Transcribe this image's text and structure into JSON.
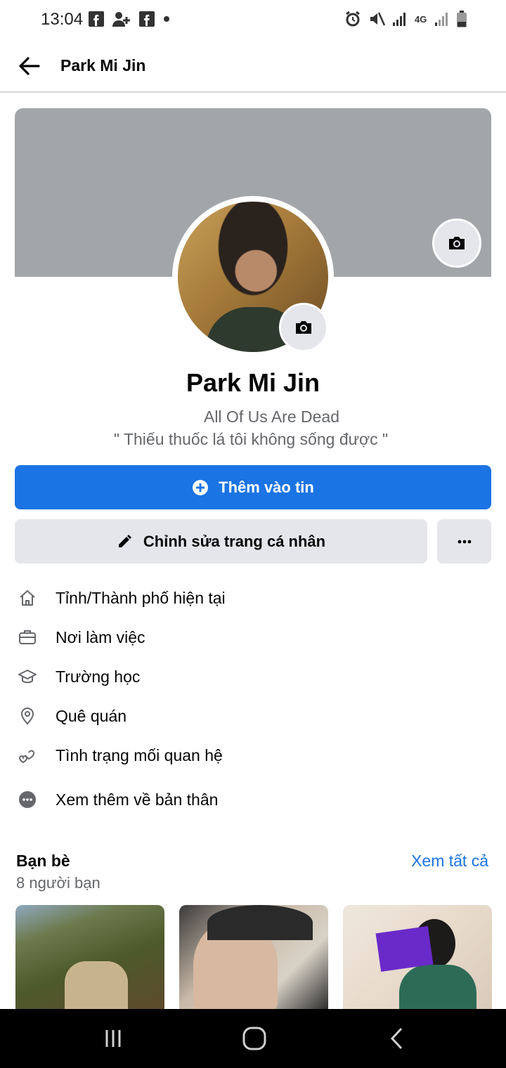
{
  "status_bar": {
    "time": "13:04",
    "network_label": "4G"
  },
  "header": {
    "title": "Park Mi Jin"
  },
  "profile": {
    "name": "Park Mi Jin",
    "subtitle": "All Of Us Are Dead",
    "quote": "\" Thiếu thuốc lá tôi không sống được \""
  },
  "actions": {
    "add_story_label": "Thêm vào tin",
    "edit_profile_label": "Chỉnh sửa trang cá nhân"
  },
  "details": [
    {
      "icon": "home-icon",
      "label": "Tỉnh/Thành phố hiện tại"
    },
    {
      "icon": "briefcase-icon",
      "label": "Nơi làm việc"
    },
    {
      "icon": "graduation-cap-icon",
      "label": "Trường học"
    },
    {
      "icon": "location-pin-icon",
      "label": "Quê quán"
    },
    {
      "icon": "hearts-icon",
      "label": "Tình trạng mối quan hệ"
    },
    {
      "icon": "more-dots-icon",
      "label": "Xem thêm về bản thân"
    }
  ],
  "friends": {
    "title": "Bạn bè",
    "see_all": "Xem tất cả",
    "count_text": "8 người bạn"
  },
  "colors": {
    "primary": "#1b74e4",
    "secondary_button": "#e4e6eb",
    "cover": "#a3a6a9",
    "muted_text": "#65676b"
  }
}
